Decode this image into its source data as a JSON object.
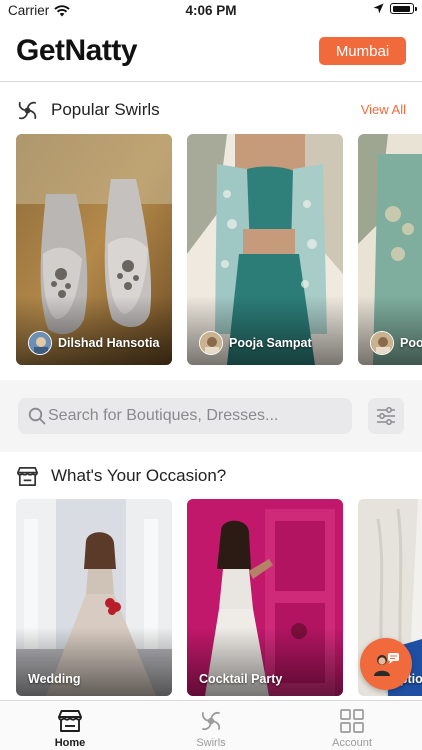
{
  "status_bar": {
    "carrier": "Carrier",
    "time": "4:06 PM",
    "battery_level": 0.9
  },
  "header": {
    "logo": "GetNatty",
    "city": "Mumbai"
  },
  "popular_swirls": {
    "title": "Popular Swirls",
    "view_all": "View All",
    "items": [
      {
        "name": "Dilshad Hansotia",
        "image": "embroidered-mules"
      },
      {
        "name": "Pooja Sampat",
        "image": "teal-lehenga-jacket"
      },
      {
        "name": "Pooja Sampat",
        "image": "green-embroidered-outfit"
      }
    ]
  },
  "search": {
    "placeholder": "Search for Boutiques, Dresses..."
  },
  "occasions": {
    "title": "What's Your Occasion?",
    "items": [
      {
        "label": "Wedding",
        "image": "silver-lehenga"
      },
      {
        "label": "Cocktail Party",
        "image": "ivory-drape-gown"
      },
      {
        "label": "Reception",
        "image": "white-drape"
      }
    ]
  },
  "tabs": [
    {
      "label": "Home",
      "icon": "storefront-icon",
      "active": true
    },
    {
      "label": "Swirls",
      "icon": "swirl-icon",
      "active": false
    },
    {
      "label": "Account",
      "icon": "grid-icon",
      "active": false
    }
  ],
  "colors": {
    "accent": "#f06a3c",
    "tab_active": "#1d1d1f",
    "tab_inactive": "#9b9b9b"
  }
}
